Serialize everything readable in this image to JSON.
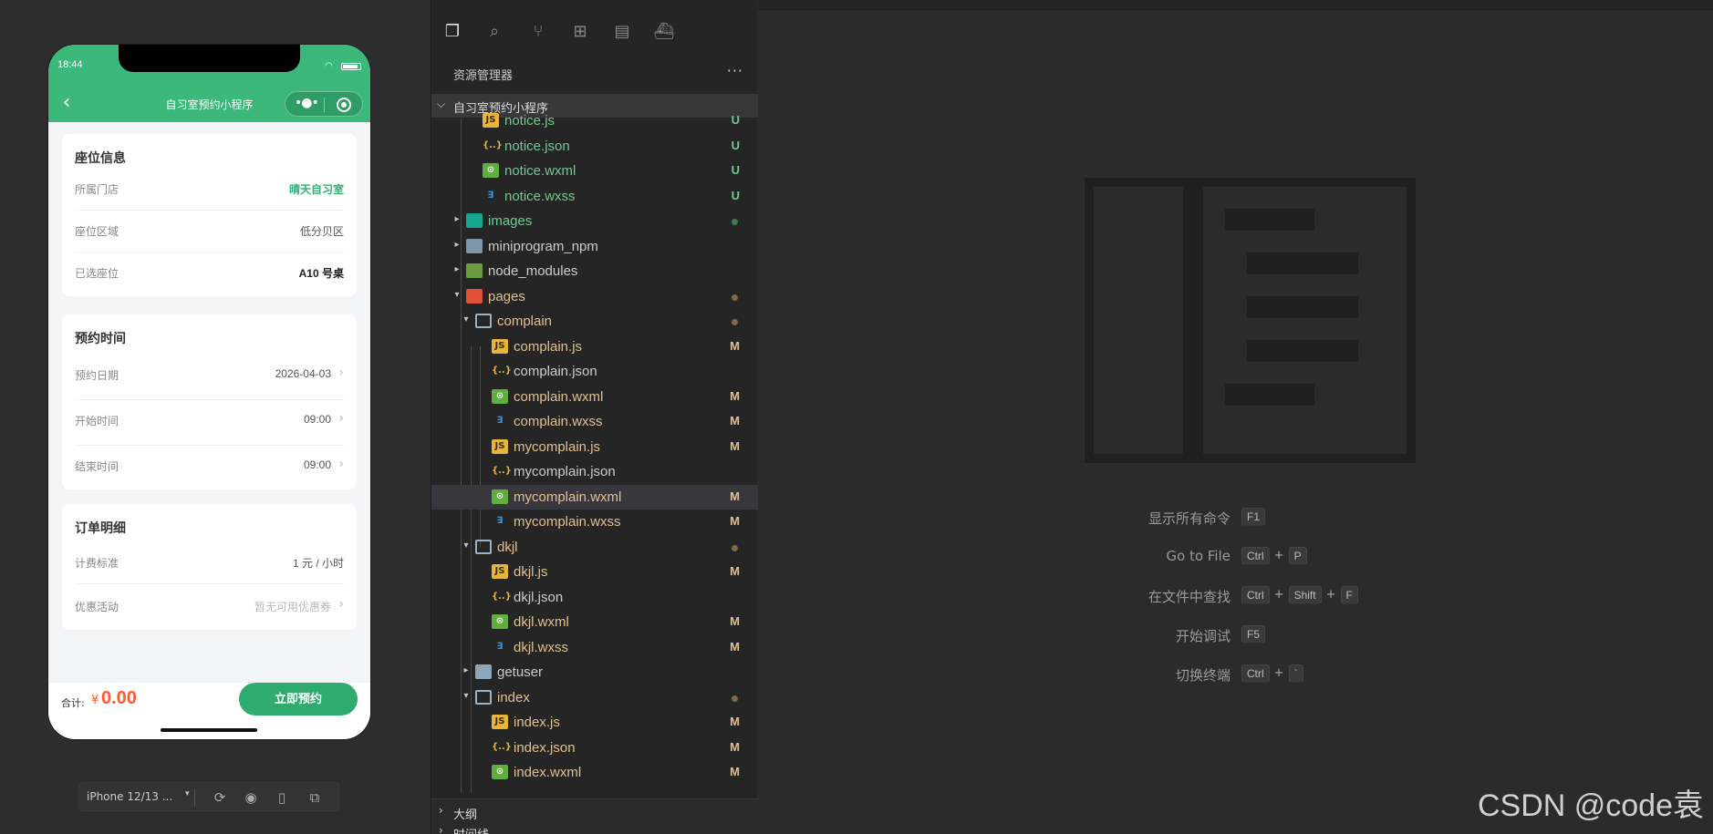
{
  "simulator": {
    "clock": "18:44",
    "nav_title": "自习室预约小程序",
    "seat_card": {
      "title": "座位信息",
      "rows": [
        {
          "label": "所属门店",
          "value": "晴天自习室"
        },
        {
          "label": "座位区域",
          "value": "低分贝区"
        },
        {
          "label": "已选座位",
          "value": "A10 号桌"
        }
      ]
    },
    "time_card": {
      "title": "预约时间",
      "rows": [
        {
          "label": "预约日期",
          "value": "2026-04-03"
        },
        {
          "label": "开始时间",
          "value": "09:00"
        },
        {
          "label": "结束时间",
          "value": "09:00"
        }
      ]
    },
    "order_card": {
      "title": "订单明细",
      "rows": [
        {
          "label": "计费标准",
          "value": "1 元 / 小时"
        },
        {
          "label": "优惠活动",
          "value": "暂无可用优惠券"
        }
      ]
    },
    "bottom": {
      "total_label": "合计:",
      "currency": "¥",
      "amount": "0.00",
      "book_button": "立即预约"
    },
    "device_toolbar": {
      "device": "iPhone 12/13 ...",
      "caret": "▾"
    }
  },
  "explorer": {
    "title": "资源管理器",
    "more": "···",
    "project": "自习室预约小程序",
    "tree": [
      {
        "name": "notice.js",
        "type": "js",
        "badge": "U",
        "status": "untracked"
      },
      {
        "name": "notice.json",
        "type": "json",
        "badge": "U",
        "status": "untracked"
      },
      {
        "name": "notice.wxml",
        "type": "wxml",
        "badge": "U",
        "status": "untracked"
      },
      {
        "name": "notice.wxss",
        "type": "wxss",
        "badge": "U",
        "status": "untracked"
      },
      {
        "name": "images",
        "type": "img-folder",
        "badge": "",
        "status": "untracked-dot"
      },
      {
        "name": "miniprogram_npm",
        "type": "npm-folder",
        "badge": "",
        "status": "normal"
      },
      {
        "name": "node_modules",
        "type": "node-folder",
        "badge": "",
        "status": "normal"
      },
      {
        "name": "pages",
        "type": "pages-folder",
        "badge": "",
        "status": "modified-dot"
      },
      {
        "name": "complain",
        "type": "folder-open",
        "badge": "",
        "status": "modified-dot"
      },
      {
        "name": "complain.js",
        "type": "js",
        "badge": "M",
        "status": "modified"
      },
      {
        "name": "complain.json",
        "type": "json",
        "badge": "",
        "status": "normal"
      },
      {
        "name": "complain.wxml",
        "type": "wxml",
        "badge": "M",
        "status": "modified"
      },
      {
        "name": "complain.wxss",
        "type": "wxss",
        "badge": "M",
        "status": "modified"
      },
      {
        "name": "mycomplain.js",
        "type": "js",
        "badge": "M",
        "status": "modified"
      },
      {
        "name": "mycomplain.json",
        "type": "json",
        "badge": "",
        "status": "normal"
      },
      {
        "name": "mycomplain.wxml",
        "type": "wxml",
        "badge": "M",
        "status": "modified"
      },
      {
        "name": "mycomplain.wxss",
        "type": "wxss",
        "badge": "M",
        "status": "modified"
      },
      {
        "name": "dkjl",
        "type": "folder-open",
        "badge": "",
        "status": "modified-dot"
      },
      {
        "name": "dkjl.js",
        "type": "js",
        "badge": "M",
        "status": "modified"
      },
      {
        "name": "dkjl.json",
        "type": "json",
        "badge": "",
        "status": "normal"
      },
      {
        "name": "dkjl.wxml",
        "type": "wxml",
        "badge": "M",
        "status": "modified"
      },
      {
        "name": "dkjl.wxss",
        "type": "wxss",
        "badge": "M",
        "status": "modified"
      },
      {
        "name": "getuser",
        "type": "folder",
        "badge": "",
        "status": "normal"
      },
      {
        "name": "index",
        "type": "folder-open",
        "badge": "",
        "status": "modified-dot"
      },
      {
        "name": "index.js",
        "type": "js",
        "badge": "M",
        "status": "modified"
      },
      {
        "name": "index.json",
        "type": "json",
        "badge": "M",
        "status": "modified"
      },
      {
        "name": "index.wxml",
        "type": "wxml",
        "badge": "M",
        "status": "modified"
      }
    ],
    "outline": "大纲",
    "timeline": "时间线"
  },
  "editor": {
    "shortcuts": [
      {
        "label": "显示所有命令",
        "keys": [
          "F1"
        ]
      },
      {
        "label": "Go to File",
        "keys": [
          "Ctrl",
          "P"
        ]
      },
      {
        "label": "在文件中查找",
        "keys": [
          "Ctrl",
          "Shift",
          "F"
        ]
      },
      {
        "label": "开始调试",
        "keys": [
          "F5"
        ]
      },
      {
        "label": "切换终端",
        "keys": [
          "Ctrl",
          "`"
        ]
      }
    ],
    "plus": "+",
    "watermark": "CSDN @code袁"
  },
  "colors": {
    "brand_green": "#3bb87a",
    "price_orange": "#ff5a2c",
    "untracked_green": "#73c991",
    "modified_gold": "#e2c08d"
  }
}
